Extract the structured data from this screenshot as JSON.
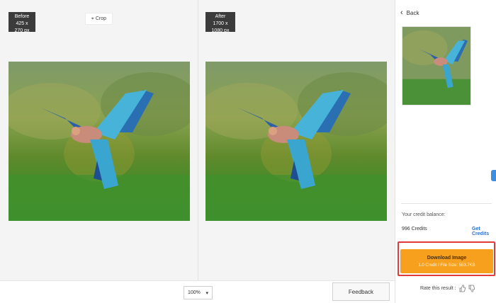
{
  "before": {
    "label": "Before",
    "dims": "425 x 270 px"
  },
  "after": {
    "label": "After",
    "dims": "1700 x 1080 px"
  },
  "crop": {
    "label": "Crop",
    "icon": "crop-icon"
  },
  "zoom": {
    "value": "100%"
  },
  "feedback": {
    "label": "Feedback"
  },
  "sidebar": {
    "back_label": "Back",
    "credit_label": "Your credit balance:",
    "credits": "996 Credits",
    "get_credits": "Get Credits",
    "download": {
      "label": "Download Image",
      "sublabel": "1.0 Credit / File Size: 553.7KB"
    },
    "rate_label": "Rate this result :"
  },
  "colors": {
    "accent": "#f7a01e",
    "highlight": "#e23b3b",
    "link": "#2a6fd1"
  }
}
